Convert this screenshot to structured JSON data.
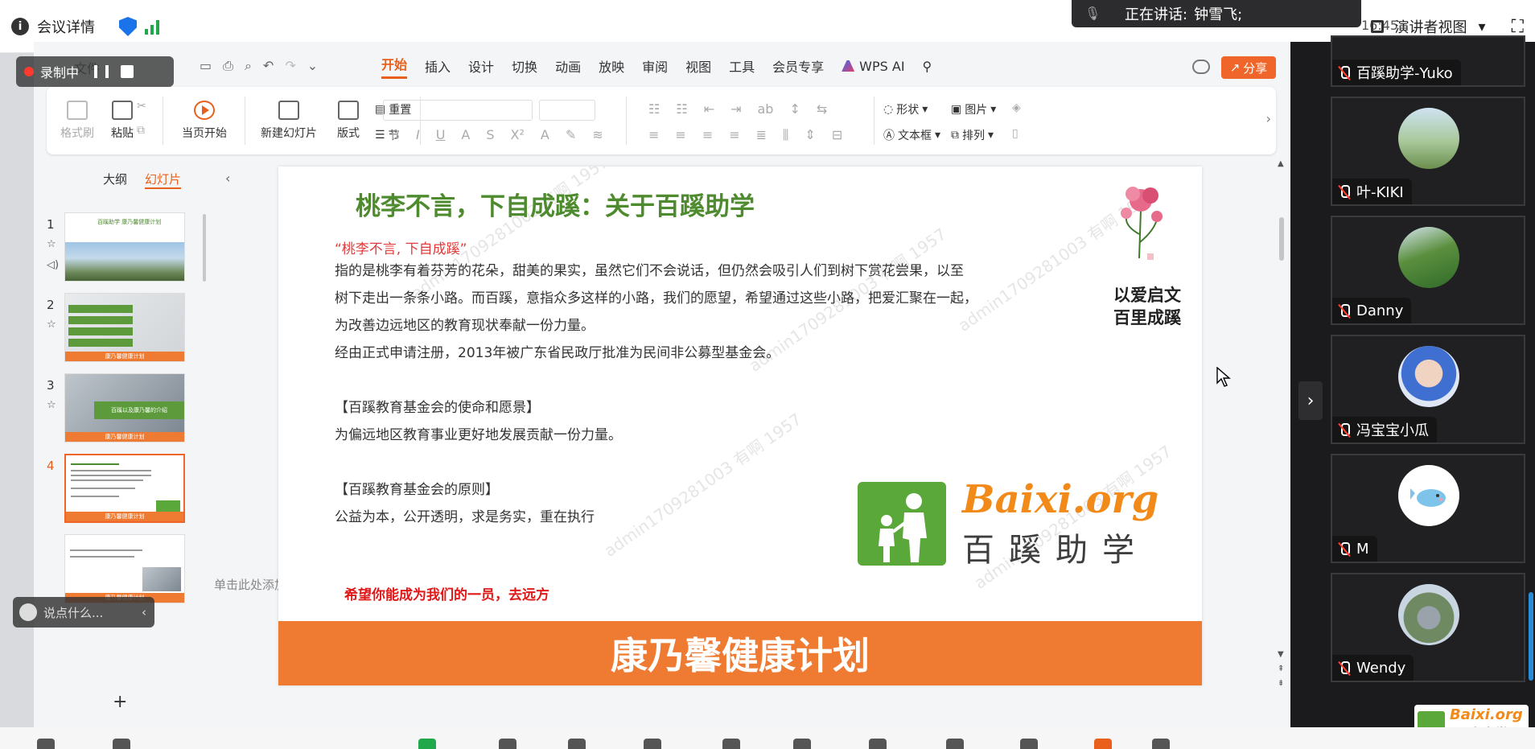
{
  "meeting": {
    "details_label": "会议详情",
    "speaking_label": "正在讲话:",
    "speaking_name": "钟雪飞;",
    "time": "16:45",
    "view_label": "演讲者视图",
    "recording_label": "录制中",
    "comment_placeholder": "说点什么..."
  },
  "wps": {
    "file_label": "文件",
    "tabs": [
      "开始",
      "插入",
      "设计",
      "切换",
      "动画",
      "放映",
      "审阅",
      "视图",
      "工具",
      "会员专享"
    ],
    "active_tab": "开始",
    "ai_label": "WPS AI",
    "share_label": "分享",
    "ribbon": {
      "format_painter": "格式刷",
      "paste": "粘贴",
      "start_from_current": "当页开始",
      "new_slide": "新建幻灯片",
      "layout": "版式",
      "reset": "重置",
      "section": "节",
      "shape": "形状",
      "picture": "图片",
      "textbox": "文本框",
      "arrange": "排列"
    },
    "panel_tabs": [
      "大纲",
      "幻灯片"
    ],
    "panel_active": "幻灯片",
    "thumbnails": [
      {
        "num": "1"
      },
      {
        "num": "2"
      },
      {
        "num": "3"
      },
      {
        "num": "4"
      },
      {
        "num": "5"
      }
    ],
    "thumb_band_label": "康乃馨健康计划",
    "thumb3_label": "百蹊以及康乃馨的介绍",
    "thumb1_title": "百蹊助学 康乃馨健康计划",
    "notes_placeholder": "单击此处添加备注"
  },
  "slide": {
    "title": "桃李不言，下自成蹊：关于百蹊助学",
    "quote": "“桃李不言, 下自成蹊”",
    "body": "指的是桃李有着芬芳的花朵，甜美的果实，虽然它们不会说话，但仍然会吸引人们到树下赏花尝果，以至\n树下走出一条条小路。而百蹊，意指众多这样的小路，我们的愿望，希望通过这些小路，把爱汇聚在一起，\n为改善边远地区的教育现状奉献一份力量。\n经由正式申请注册，2013年被广东省民政厅批准为民间非公募型基金会。\n\n【百蹊教育基金会的使命和愿景】\n为偏远地区教育事业更好地发展贡献一份力量。\n\n【百蹊教育基金会的原则】\n公益为本，公开透明，求是务实，重在执行",
    "cta": "希望你能成为我们的一员，去远方",
    "motto_line1": "以爱启文",
    "motto_line2": "百里成蹊",
    "logo_en": "Baixi.org",
    "logo_cn": "百蹊助学",
    "footer": "康乃馨健康计划"
  },
  "watermark": "admin1709281003 有啊 1957",
  "participants": [
    {
      "name": "百蹊助学-Yuko",
      "avatar": "photo-field"
    },
    {
      "name": "叶-KIKI",
      "avatar": "photo-field"
    },
    {
      "name": "Danny",
      "avatar": "photo-mountain"
    },
    {
      "name": "冯宝宝小瓜",
      "avatar": "photo-child"
    },
    {
      "name": "M",
      "avatar": "whale-cartoon"
    },
    {
      "name": "Wendy",
      "avatar": "photo-building"
    }
  ],
  "colors": {
    "accent": "#e8601c",
    "title_green": "#4e8b2e",
    "footer_orange": "#ef7b32",
    "panel_bg": "#1b1b1d"
  }
}
